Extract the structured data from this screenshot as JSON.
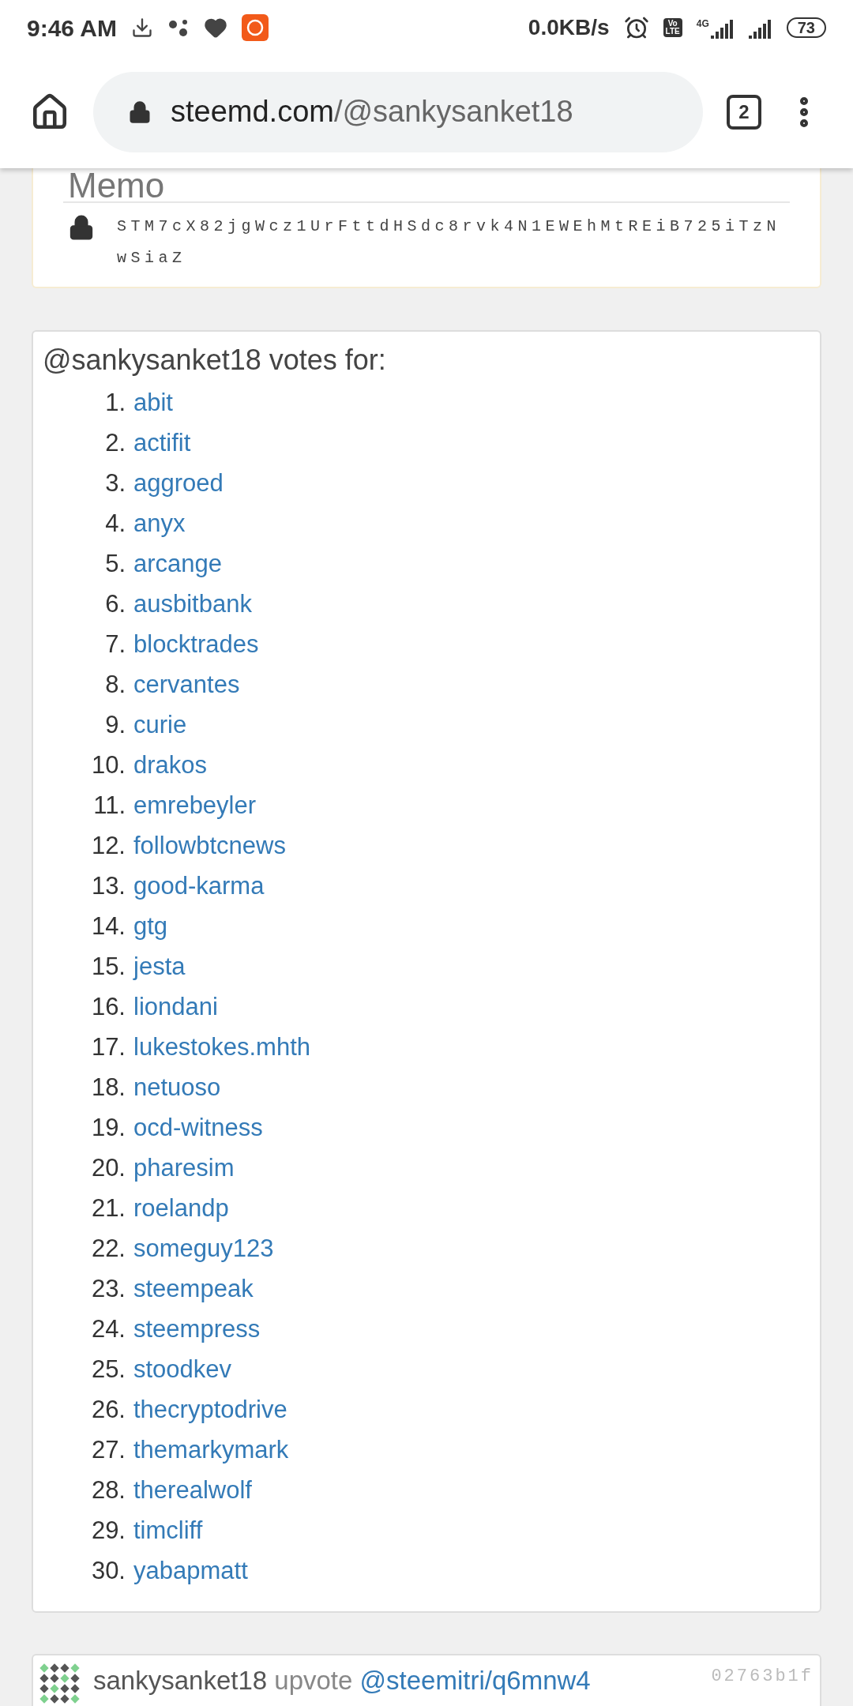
{
  "status_bar": {
    "time": "9:46 AM",
    "speed": "0.0KB/s",
    "volte": [
      "Vo",
      "LTE"
    ],
    "network": "4G",
    "battery": "73"
  },
  "toolbar": {
    "url_host": "steemd.com",
    "url_path": "/@sankysanket18",
    "tab_count": "2"
  },
  "memo_card": {
    "title": "Memo",
    "key": "STM7cX82jgWcz1UrFttdHSdc8rvk4N1EWEhMtREiB725iTzNwSiaZ"
  },
  "votes_card": {
    "heading": "@sankysanket18 votes for:",
    "witnesses": [
      {
        "number": "1.",
        "name": "abit"
      },
      {
        "number": "2.",
        "name": "actifit"
      },
      {
        "number": "3.",
        "name": "aggroed"
      },
      {
        "number": "4.",
        "name": "anyx"
      },
      {
        "number": "5.",
        "name": "arcange"
      },
      {
        "number": "6.",
        "name": "ausbitbank"
      },
      {
        "number": "7.",
        "name": "blocktrades"
      },
      {
        "number": "8.",
        "name": "cervantes"
      },
      {
        "number": "9.",
        "name": "curie"
      },
      {
        "number": "10.",
        "name": "drakos"
      },
      {
        "number": "11.",
        "name": "emrebeyler"
      },
      {
        "number": "12.",
        "name": "followbtcnews"
      },
      {
        "number": "13.",
        "name": "good-karma"
      },
      {
        "number": "14.",
        "name": "gtg"
      },
      {
        "number": "15.",
        "name": "jesta"
      },
      {
        "number": "16.",
        "name": "liondani"
      },
      {
        "number": "17.",
        "name": "lukestokes.mhth"
      },
      {
        "number": "18.",
        "name": "netuoso"
      },
      {
        "number": "19.",
        "name": "ocd-witness"
      },
      {
        "number": "20.",
        "name": "pharesim"
      },
      {
        "number": "21.",
        "name": "roelandp"
      },
      {
        "number": "22.",
        "name": "someguy123"
      },
      {
        "number": "23.",
        "name": "steempeak"
      },
      {
        "number": "24.",
        "name": "steempress"
      },
      {
        "number": "25.",
        "name": "stoodkev"
      },
      {
        "number": "26.",
        "name": "thecryptodrive"
      },
      {
        "number": "27.",
        "name": "themarkymark"
      },
      {
        "number": "28.",
        "name": "therealwolf"
      },
      {
        "number": "29.",
        "name": "timcliff"
      },
      {
        "number": "30.",
        "name": "yabapmatt"
      }
    ]
  },
  "operation_card": {
    "user": "sankysanket18",
    "action": "upvote",
    "target": "@steemitri/q6mnw4",
    "tx_id": "02763b1f"
  }
}
